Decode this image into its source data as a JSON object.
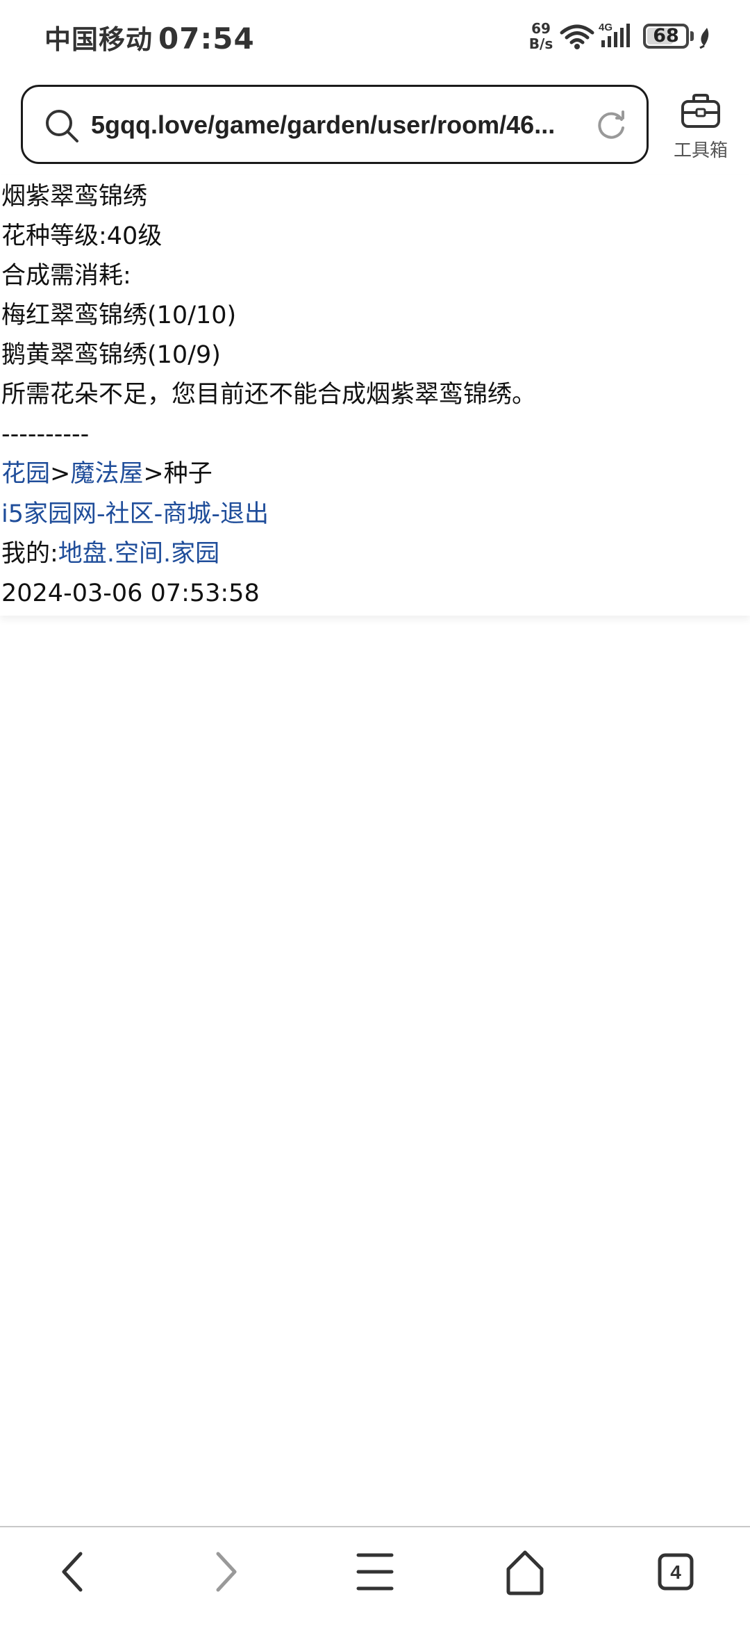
{
  "status_bar": {
    "carrier": "中国移动",
    "time": "07:54",
    "net_speed_value": "69",
    "net_speed_unit": "B/s",
    "network_type": "4G",
    "battery_level": "68",
    "battery_fraction": 0.68
  },
  "address_bar": {
    "url": "5gqq.love/game/garden/user/room/46..."
  },
  "toolbox": {
    "label": "工具箱"
  },
  "content": {
    "title": "烟紫翠鸾锦绣",
    "level": "花种等级:40级",
    "cost_heading": "合成需消耗:",
    "materials": [
      "梅红翠鸾锦绣(10/10)",
      "鹅黄翠鸾锦绣(10/9)"
    ],
    "message": "所需花朵不足，您目前还不能合成烟紫翠鸾锦绣。",
    "divider": "----------",
    "breadcrumb": {
      "garden": "花园",
      "sep1": ">",
      "magic_house": "魔法屋",
      "sep2": ">",
      "current": "种子"
    },
    "site_links": {
      "home": "i5家园网",
      "sep1": "-",
      "community": "社区",
      "sep2": "-",
      "mall": "商城",
      "sep3": "-",
      "logout": "退出"
    },
    "mine": {
      "label": "我的:",
      "land": "地盘",
      "dot1": ".",
      "space": "空间",
      "dot2": ".",
      "homeland": "家园"
    },
    "timestamp": "2024-03-06 07:53:58"
  },
  "bottom_nav": {
    "tab_count": "4",
    "icons": [
      "back-icon",
      "forward-icon",
      "menu-icon",
      "home-icon",
      "tabs-icon"
    ]
  }
}
